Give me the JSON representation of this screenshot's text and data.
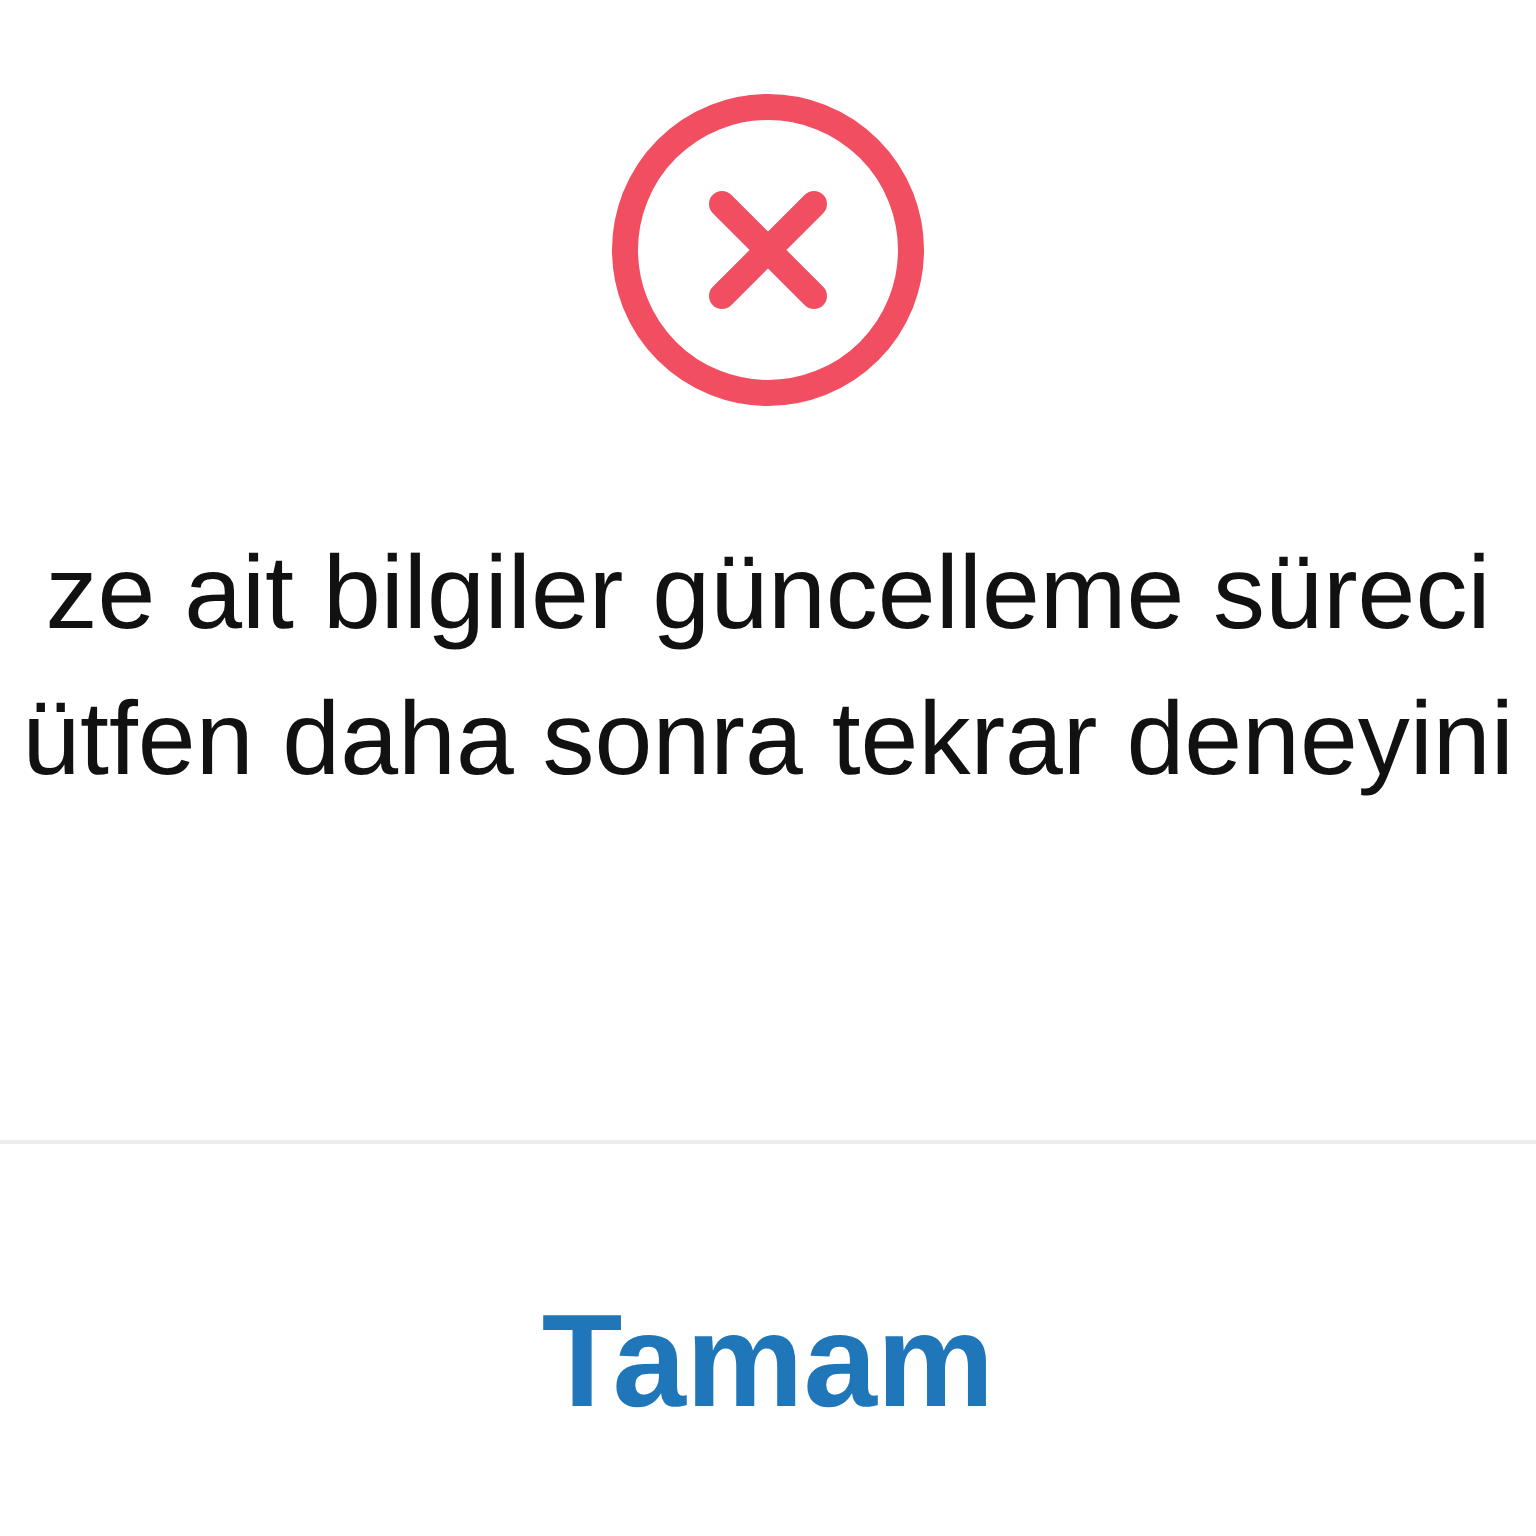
{
  "dialog": {
    "message_lines": [
      "ze ait bilgiler güncelleme süreci",
      "ütfen daha sonra tekrar deneyini"
    ],
    "buttons": [
      {
        "label": "Tamam"
      }
    ]
  }
}
